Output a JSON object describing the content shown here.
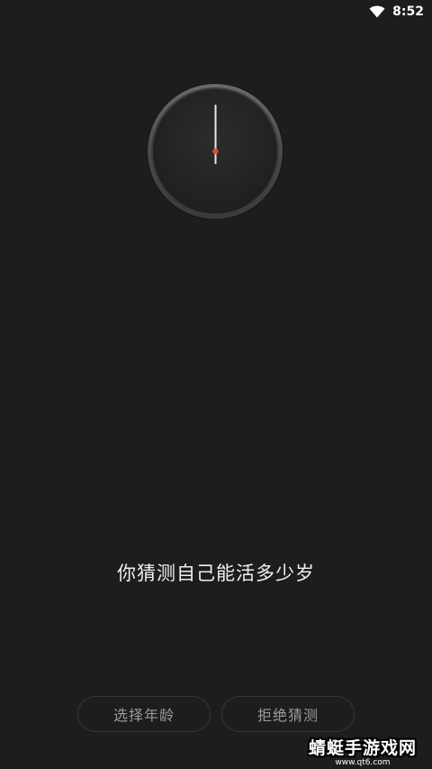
{
  "status_bar": {
    "time": "8:52",
    "wifi_icon": "wifi-icon"
  },
  "clock": {
    "icon": "clock-icon",
    "accent_color": "#e34a2f"
  },
  "main": {
    "question": "你猜测自己能活多少岁"
  },
  "buttons": {
    "choose_age": "选择年龄",
    "refuse_guess": "拒绝猜测"
  },
  "watermark": {
    "name": "蜻蜓手游戏网",
    "url": "www.qt6.com"
  }
}
